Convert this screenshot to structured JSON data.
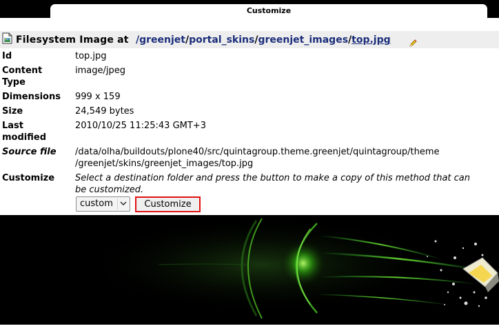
{
  "tab": {
    "label": "Customize"
  },
  "header": {
    "title": "Filesystem Image at",
    "path": [
      {
        "label": "/greenjet",
        "sep": ""
      },
      {
        "label": "portal_skins",
        "sep": "/"
      },
      {
        "label": "greenjet_images",
        "sep": "/"
      },
      {
        "label": "top.jpg",
        "sep": "/"
      }
    ]
  },
  "properties": {
    "id": {
      "label": "Id",
      "value": "top.jpg"
    },
    "content_type": {
      "label_line1": "Content",
      "label_line2": "Type",
      "value": "image/jpeg"
    },
    "dimensions": {
      "label": "Dimensions",
      "value": "999 x 159"
    },
    "size": {
      "label": "Size",
      "value": "24,549 bytes"
    },
    "last_modified": {
      "label_line1": "Last",
      "label_line2": "modified",
      "value": "2010/10/25 11:25:43 GMT+3"
    },
    "source_file": {
      "label": "Source file",
      "value_line1": "/data/olha/buildouts/plone40/src/quintagroup.theme.greenjet/quintagroup/theme",
      "value_line2": "/greenjet/skins/greenjet_images/top.jpg"
    },
    "customize": {
      "label": "Customize",
      "help_line1": "Select a destination folder and press the button to make a copy of this method that can",
      "help_line2": "be customized."
    }
  },
  "form": {
    "folder_select": "custom",
    "customize_button": "Customize"
  },
  "icons": {
    "image": "image-file-icon",
    "edit": "pencil-icon",
    "dropdown": "chevron-down-icon"
  },
  "colors": {
    "path_link": "#1b2d7a",
    "button_border": "#e01010",
    "title_bg": "#eeeeee",
    "banner_glow": "#39ff14"
  }
}
